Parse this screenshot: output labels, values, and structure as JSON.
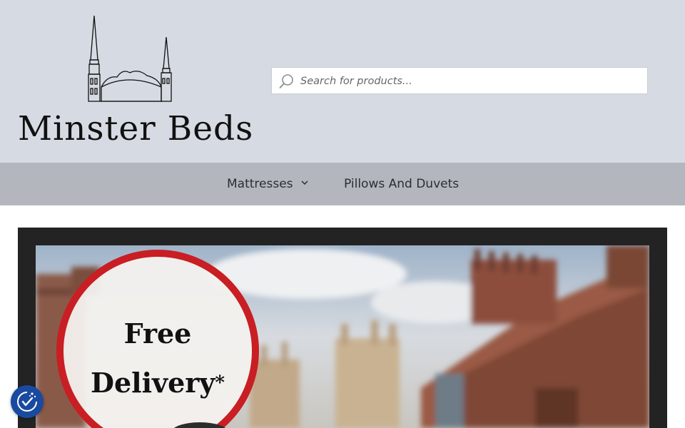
{
  "brand": {
    "name": "Minster Beds"
  },
  "search": {
    "placeholder": "Search for products..."
  },
  "nav": {
    "items": [
      {
        "label": "Mattresses",
        "has_dropdown": true
      },
      {
        "label": "Pillows And Duvets",
        "has_dropdown": false
      }
    ]
  },
  "banner": {
    "promo_line1": "Free",
    "promo_line2": "Delivery",
    "promo_asterisk": "*"
  },
  "cookie": {
    "icon": "cookie-consent-icon"
  },
  "colors": {
    "header_bg": "#d6dbe3",
    "nav_bg": "#b3b7bd",
    "promo_ring": "#c81e24",
    "cookie_button": "#1a4aa0"
  }
}
